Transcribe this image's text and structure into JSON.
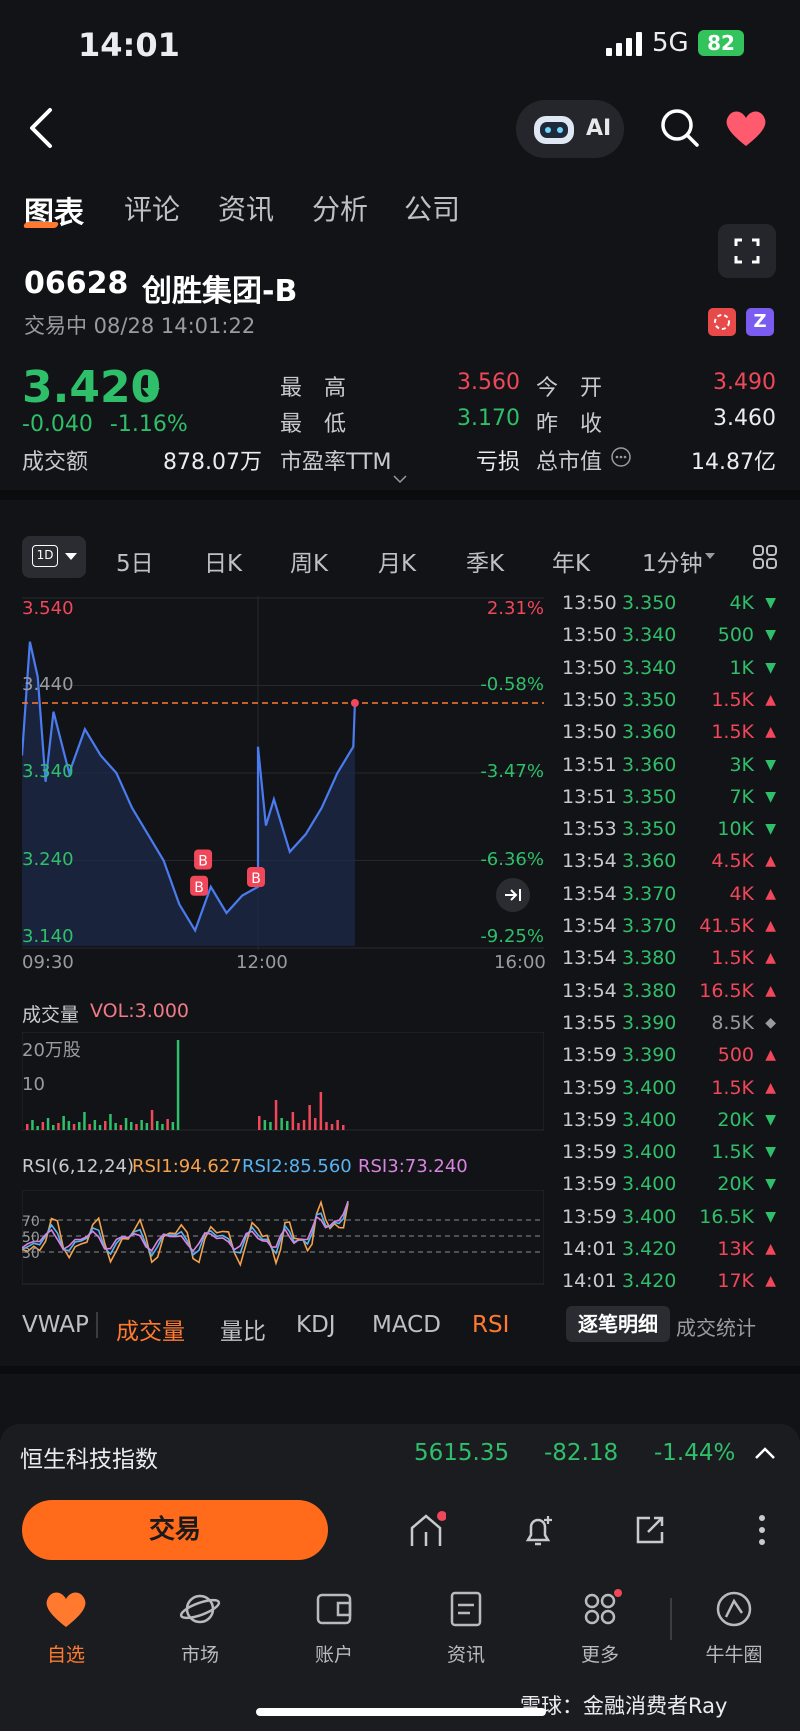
{
  "status_bar": {
    "time": "14:01",
    "network": "5G",
    "battery": "82"
  },
  "nav": {
    "ai_label": "AI"
  },
  "tabs": [
    "图表",
    "评论",
    "资讯",
    "分析",
    "公司"
  ],
  "stock": {
    "code": "06628",
    "name": "创胜集团-B",
    "status": "交易中 08/28 14:01:22",
    "price": "3.420",
    "change": "-0.040",
    "change_pct": "-1.16%",
    "badge2": "Z"
  },
  "quote": {
    "high_label": "最　高",
    "high": "3.560",
    "open_label": "今　开",
    "open": "3.490",
    "low_label": "最　低",
    "low": "3.170",
    "prev_label": "昨　收",
    "prev": "3.460",
    "turnover_label": "成交额",
    "turnover": "878.07万",
    "pe_label": "市盈率TTM",
    "pe": "亏损",
    "mcap_label": "总市值",
    "mcap": "14.87亿"
  },
  "periods": {
    "active": "1D",
    "items": [
      "5日",
      "日K",
      "周K",
      "月K",
      "季K",
      "年K"
    ],
    "minute": "1分钟"
  },
  "chart_data": {
    "type": "line",
    "title": "",
    "y_ticks": [
      "3.540",
      "3.440",
      "3.340",
      "3.240",
      "3.140"
    ],
    "pct_ticks": [
      "2.31%",
      "-0.58%",
      "-3.47%",
      "-6.36%",
      "-9.25%"
    ],
    "x_ticks": [
      "09:30",
      "12:00",
      "16:00"
    ],
    "ylim": [
      3.14,
      3.54
    ],
    "prev_close": 3.46,
    "last": 3.42,
    "series": [
      {
        "x": [
          "09:30",
          "09:35",
          "09:40",
          "09:45",
          "09:50",
          "10:00",
          "10:10",
          "10:20",
          "10:30",
          "10:40",
          "10:50",
          "11:00",
          "11:10",
          "11:20",
          "11:30",
          "11:40",
          "11:50",
          "12:00",
          "13:00",
          "13:05",
          "13:10",
          "13:20",
          "13:30",
          "13:40",
          "13:50",
          "14:00",
          "14:01"
        ],
        "values": [
          3.36,
          3.49,
          3.45,
          3.33,
          3.41,
          3.34,
          3.39,
          3.36,
          3.34,
          3.3,
          3.27,
          3.24,
          3.19,
          3.16,
          3.21,
          3.18,
          3.2,
          3.21,
          3.37,
          3.28,
          3.31,
          3.25,
          3.27,
          3.3,
          3.34,
          3.37,
          3.42
        ]
      }
    ],
    "markers": [
      "B",
      "B",
      "B"
    ]
  },
  "volume": {
    "label": "成交量",
    "value": "VOL:3.000",
    "unit": "20万股",
    "mid": "10"
  },
  "rsi": {
    "label": "RSI(6,12,24)",
    "rsi1": "RSI1:94.627",
    "rsi2": "RSI2:85.560",
    "rsi3": "RSI3:73.240",
    "levels": [
      "70",
      "50",
      "30"
    ]
  },
  "trades": [
    {
      "time": "13:50",
      "price": "3.350",
      "vol": "4K",
      "dir": "down"
    },
    {
      "time": "13:50",
      "price": "3.340",
      "vol": "500",
      "dir": "down"
    },
    {
      "time": "13:50",
      "price": "3.340",
      "vol": "1K",
      "dir": "down"
    },
    {
      "time": "13:50",
      "price": "3.350",
      "vol": "1.5K",
      "dir": "up"
    },
    {
      "time": "13:50",
      "price": "3.360",
      "vol": "1.5K",
      "dir": "up"
    },
    {
      "time": "13:51",
      "price": "3.360",
      "vol": "3K",
      "dir": "down"
    },
    {
      "time": "13:51",
      "price": "3.350",
      "vol": "7K",
      "dir": "down"
    },
    {
      "time": "13:53",
      "price": "3.350",
      "vol": "10K",
      "dir": "down"
    },
    {
      "time": "13:54",
      "price": "3.360",
      "vol": "4.5K",
      "dir": "up"
    },
    {
      "time": "13:54",
      "price": "3.370",
      "vol": "4K",
      "dir": "up"
    },
    {
      "time": "13:54",
      "price": "3.370",
      "vol": "41.5K",
      "dir": "up"
    },
    {
      "time": "13:54",
      "price": "3.380",
      "vol": "1.5K",
      "dir": "up"
    },
    {
      "time": "13:54",
      "price": "3.380",
      "vol": "16.5K",
      "dir": "up"
    },
    {
      "time": "13:55",
      "price": "3.390",
      "vol": "8.5K",
      "dir": "neutral"
    },
    {
      "time": "13:59",
      "price": "3.390",
      "vol": "500",
      "dir": "up"
    },
    {
      "time": "13:59",
      "price": "3.400",
      "vol": "1.5K",
      "dir": "up"
    },
    {
      "time": "13:59",
      "price": "3.400",
      "vol": "20K",
      "dir": "down"
    },
    {
      "time": "13:59",
      "price": "3.400",
      "vol": "1.5K",
      "dir": "down"
    },
    {
      "time": "13:59",
      "price": "3.400",
      "vol": "20K",
      "dir": "down"
    },
    {
      "time": "13:59",
      "price": "3.400",
      "vol": "16.5K",
      "dir": "down"
    },
    {
      "time": "14:01",
      "price": "3.420",
      "vol": "13K",
      "dir": "up"
    },
    {
      "time": "14:01",
      "price": "3.420",
      "vol": "17K",
      "dir": "up"
    }
  ],
  "indicators": [
    "VWAP",
    "成交量",
    "量比",
    "KDJ",
    "MACD",
    "RSI"
  ],
  "trade_tabs": [
    "逐笔明细",
    "成交统计"
  ],
  "index_bar": {
    "name": "恒生科技指数",
    "value": "5615.35",
    "change": "-82.18",
    "pct": "-1.44%"
  },
  "actions": {
    "trade": "交易"
  },
  "tabbar": [
    "自选",
    "市场",
    "账户",
    "资讯",
    "更多",
    "牛牛圈"
  ],
  "watermark": "雪球：金融消费者Ray",
  "colors": {
    "up": "#f0475a",
    "down": "#2fbf6a",
    "accent": "#ff7a2f",
    "line": "#4a7cf0"
  }
}
